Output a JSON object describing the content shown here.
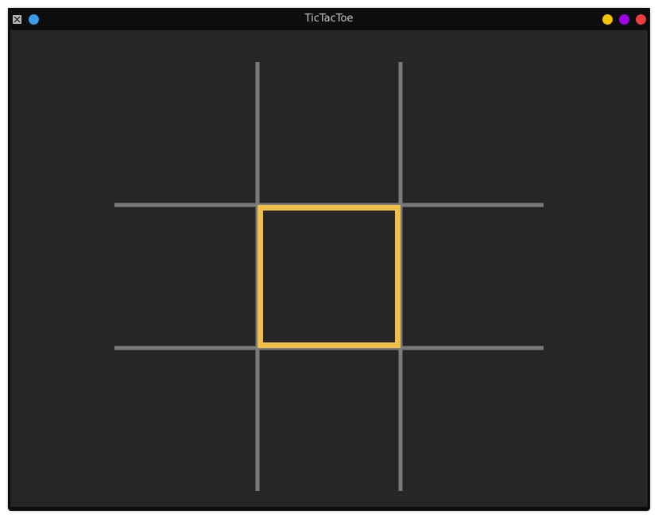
{
  "window": {
    "title": "TicTacToe",
    "title_color": "#c8c8cc",
    "app_icon": "x-window-icon",
    "buttons": [
      {
        "name": "pin",
        "color": "#3b9be6"
      },
      {
        "name": "minimize",
        "color": "#f5c300"
      },
      {
        "name": "maximize",
        "color": "#a000e6"
      },
      {
        "name": "close",
        "color": "#f03c3c"
      }
    ]
  },
  "game": {
    "grid_size": 3,
    "grid_color": "#7a7a7a",
    "background_color": "#262626",
    "cursor_color": "#f0bf4a",
    "selected_cell": {
      "row": 1,
      "col": 1
    },
    "cells": [
      [
        "",
        "",
        ""
      ],
      [
        "",
        "",
        ""
      ],
      [
        "",
        "",
        ""
      ]
    ]
  }
}
